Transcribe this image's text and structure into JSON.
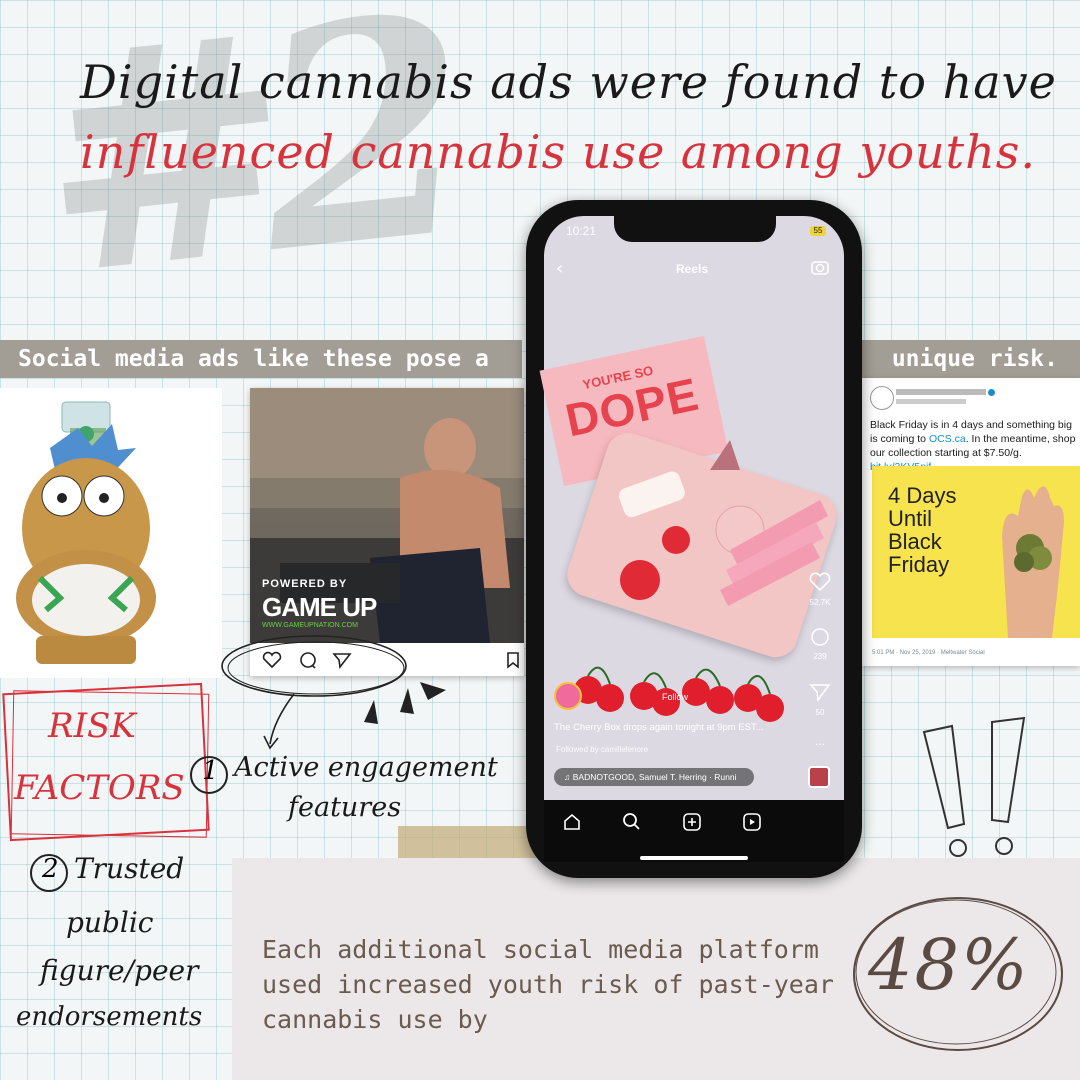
{
  "background_number": "#2",
  "headline": {
    "line1": "Digital cannabis ads were found to have",
    "line2": "influenced cannabis use among youths."
  },
  "banner": {
    "left": "Social media ads like these pose a",
    "right": "unique risk."
  },
  "gameup_post": {
    "brand_small": "POWERED BY",
    "brand": "GAME UP",
    "url": "WWW.GAMEUPNATION.COM"
  },
  "tweet": {
    "body_prefix": "Black Friday is in 4 days and something big is coming to",
    "link1": "OCS.ca",
    "body_middle": ". In the meantime, shop our collection starting at $7.50/g.",
    "link2": "bit.ly/2KV5nif",
    "ad_text": "4 Days Until Black Friday",
    "footer": "5:01 PM · Nov 25, 2019 · Meltwater Social"
  },
  "phone": {
    "time": "10:21",
    "battery": "55",
    "header": "Reels",
    "card_line1": "YOU'RE SO",
    "card_line2": "DOPE",
    "likes": "52.7K",
    "comments": "239",
    "shares": "50",
    "more": "...",
    "follow": "Follow",
    "caption": "The Cherry Box drops again tonight at 9pm EST...",
    "followed_by": "Followed by camillelenore",
    "music": "BADNOTGOOD, Samuel T. Herring · Runni"
  },
  "risk": {
    "title_line1": "RISK",
    "title_line2": "FACTORS",
    "factor1_num": "1",
    "factor1_line1": "Active engagement",
    "factor1_line2": "features",
    "factor2_num": "2",
    "factor2_line1": "Trusted",
    "factor2_line2": "public",
    "factor2_line3": "figure/peer",
    "factor2_line4": "endorsements"
  },
  "stat": {
    "text": "Each additional social media platform used increased youth risk of past-year cannabis use by",
    "value": "48%"
  },
  "colors": {
    "accent_red": "#d8323c",
    "banner_gray": "#a39e95",
    "stat_brown": "#6b5a4e"
  }
}
